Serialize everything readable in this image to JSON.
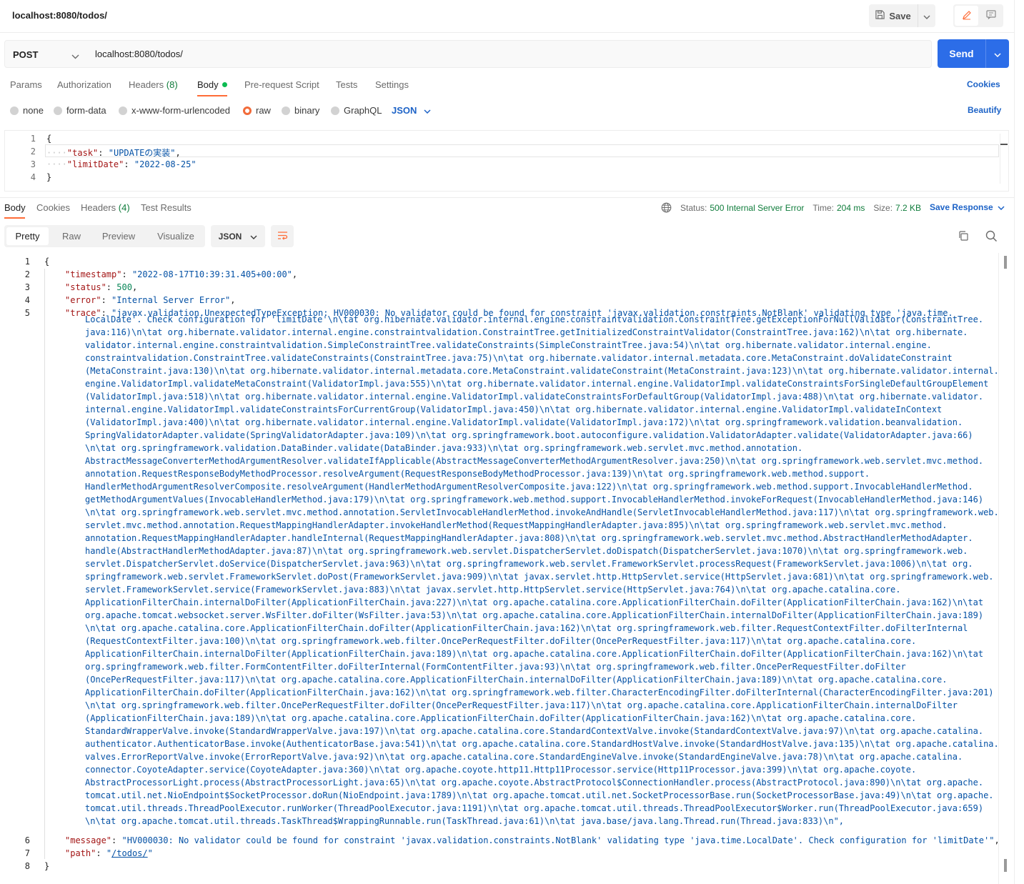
{
  "tab": {
    "title": "localhost:8080/todos/"
  },
  "toolbar": {
    "save_label": "Save"
  },
  "request": {
    "method": "POST",
    "url": "localhost:8080/todos/",
    "send_label": "Send",
    "tabs": {
      "params": "Params",
      "authorization": "Authorization",
      "headers": "Headers",
      "headers_count": "(8)",
      "body": "Body",
      "prerequest": "Pre-request Script",
      "tests": "Tests",
      "settings": "Settings"
    },
    "cookies_label": "Cookies",
    "body_modes": {
      "none": "none",
      "form_data": "form-data",
      "urlencoded": "x-www-form-urlencoded",
      "raw": "raw",
      "binary": "binary",
      "graphql": "GraphQL",
      "type": "JSON"
    },
    "beautify_label": "Beautify",
    "editor": {
      "line_numbers": [
        "1",
        "2",
        "3",
        "4"
      ],
      "open_brace": "{",
      "close_brace": "}",
      "task_key": "\"task\"",
      "task_value": "\"UPDATEの実装\"",
      "limit_key": "\"limitDate\"",
      "limit_value": "\"2022-08-25\""
    }
  },
  "response": {
    "tabs": {
      "body": "Body",
      "cookies": "Cookies",
      "headers": "Headers",
      "headers_count": "(4)",
      "test_results": "Test Results"
    },
    "status_label": "Status:",
    "status_value": "500 Internal Server Error",
    "time_label": "Time:",
    "time_value": "204 ms",
    "size_label": "Size:",
    "size_value": "7.2 KB",
    "save_response_label": "Save Response",
    "views": {
      "pretty": "Pretty",
      "raw": "Raw",
      "preview": "Preview",
      "visualize": "Visualize"
    },
    "format": "JSON",
    "line_numbers": [
      "1",
      "2",
      "3",
      "4",
      "5",
      "6",
      "7",
      "8"
    ],
    "body": {
      "open_brace": "{",
      "close_brace": "}",
      "timestamp_key": "\"timestamp\"",
      "timestamp_value": "\"2022-08-17T10:39:31.405+00:00\"",
      "status_key": "\"status\"",
      "status_value": "500",
      "error_key": "\"error\"",
      "error_value": "\"Internal Server Error\"",
      "trace_key": "\"trace\"",
      "trace_first": "\"javax.validation.UnexpectedTypeException: HV000030: No validator could be found for constraint 'javax.validation.constraints.NotBlank' validating type 'java.time.",
      "trace_lines": [
        "LocalDate'. Check configuration for 'limitDate'\\n\\tat org.hibernate.validator.internal.engine.constraintvalidation.ConstraintTree.getExceptionForNullValidator(ConstraintTree.",
        "java:116)\\n\\tat org.hibernate.validator.internal.engine.constraintvalidation.ConstraintTree.getInitializedConstraintValidator(ConstraintTree.java:162)\\n\\tat org.hibernate.",
        "validator.internal.engine.constraintvalidation.SimpleConstraintTree.validateConstraints(SimpleConstraintTree.java:54)\\n\\tat org.hibernate.validator.internal.engine.",
        "constraintvalidation.ConstraintTree.validateConstraints(ConstraintTree.java:75)\\n\\tat org.hibernate.validator.internal.metadata.core.MetaConstraint.doValidateConstraint",
        "(MetaConstraint.java:130)\\n\\tat org.hibernate.validator.internal.metadata.core.MetaConstraint.validateConstraint(MetaConstraint.java:123)\\n\\tat org.hibernate.validator.internal.",
        "engine.ValidatorImpl.validateMetaConstraint(ValidatorImpl.java:555)\\n\\tat org.hibernate.validator.internal.engine.ValidatorImpl.validateConstraintsForSingleDefaultGroupElement",
        "(ValidatorImpl.java:518)\\n\\tat org.hibernate.validator.internal.engine.ValidatorImpl.validateConstraintsForDefaultGroup(ValidatorImpl.java:488)\\n\\tat org.hibernate.validator.",
        "internal.engine.ValidatorImpl.validateConstraintsForCurrentGroup(ValidatorImpl.java:450)\\n\\tat org.hibernate.validator.internal.engine.ValidatorImpl.validateInContext",
        "(ValidatorImpl.java:400)\\n\\tat org.hibernate.validator.internal.engine.ValidatorImpl.validate(ValidatorImpl.java:172)\\n\\tat org.springframework.validation.beanvalidation.",
        "SpringValidatorAdapter.validate(SpringValidatorAdapter.java:109)\\n\\tat org.springframework.boot.autoconfigure.validation.ValidatorAdapter.validate(ValidatorAdapter.java:66)",
        "\\n\\tat org.springframework.validation.DataBinder.validate(DataBinder.java:933)\\n\\tat org.springframework.web.servlet.mvc.method.annotation.",
        "AbstractMessageConverterMethodArgumentResolver.validateIfApplicable(AbstractMessageConverterMethodArgumentResolver.java:250)\\n\\tat org.springframework.web.servlet.mvc.method.",
        "annotation.RequestResponseBodyMethodProcessor.resolveArgument(RequestResponseBodyMethodProcessor.java:139)\\n\\tat org.springframework.web.method.support.",
        "HandlerMethodArgumentResolverComposite.resolveArgument(HandlerMethodArgumentResolverComposite.java:122)\\n\\tat org.springframework.web.method.support.InvocableHandlerMethod.",
        "getMethodArgumentValues(InvocableHandlerMethod.java:179)\\n\\tat org.springframework.web.method.support.InvocableHandlerMethod.invokeForRequest(InvocableHandlerMethod.java:146)",
        "\\n\\tat org.springframework.web.servlet.mvc.method.annotation.ServletInvocableHandlerMethod.invokeAndHandle(ServletInvocableHandlerMethod.java:117)\\n\\tat org.springframework.web.",
        "servlet.mvc.method.annotation.RequestMappingHandlerAdapter.invokeHandlerMethod(RequestMappingHandlerAdapter.java:895)\\n\\tat org.springframework.web.servlet.mvc.method.",
        "annotation.RequestMappingHandlerAdapter.handleInternal(RequestMappingHandlerAdapter.java:808)\\n\\tat org.springframework.web.servlet.mvc.method.AbstractHandlerMethodAdapter.",
        "handle(AbstractHandlerMethodAdapter.java:87)\\n\\tat org.springframework.web.servlet.DispatcherServlet.doDispatch(DispatcherServlet.java:1070)\\n\\tat org.springframework.web.",
        "servlet.DispatcherServlet.doService(DispatcherServlet.java:963)\\n\\tat org.springframework.web.servlet.FrameworkServlet.processRequest(FrameworkServlet.java:1006)\\n\\tat org.",
        "springframework.web.servlet.FrameworkServlet.doPost(FrameworkServlet.java:909)\\n\\tat javax.servlet.http.HttpServlet.service(HttpServlet.java:681)\\n\\tat org.springframework.web.",
        "servlet.FrameworkServlet.service(FrameworkServlet.java:883)\\n\\tat javax.servlet.http.HttpServlet.service(HttpServlet.java:764)\\n\\tat org.apache.catalina.core.",
        "ApplicationFilterChain.internalDoFilter(ApplicationFilterChain.java:227)\\n\\tat org.apache.catalina.core.ApplicationFilterChain.doFilter(ApplicationFilterChain.java:162)\\n\\tat",
        "org.apache.tomcat.websocket.server.WsFilter.doFilter(WsFilter.java:53)\\n\\tat org.apache.catalina.core.ApplicationFilterChain.internalDoFilter(ApplicationFilterChain.java:189)",
        "\\n\\tat org.apache.catalina.core.ApplicationFilterChain.doFilter(ApplicationFilterChain.java:162)\\n\\tat org.springframework.web.filter.RequestContextFilter.doFilterInternal",
        "(RequestContextFilter.java:100)\\n\\tat org.springframework.web.filter.OncePerRequestFilter.doFilter(OncePerRequestFilter.java:117)\\n\\tat org.apache.catalina.core.",
        "ApplicationFilterChain.internalDoFilter(ApplicationFilterChain.java:189)\\n\\tat org.apache.catalina.core.ApplicationFilterChain.doFilter(ApplicationFilterChain.java:162)\\n\\tat",
        "org.springframework.web.filter.FormContentFilter.doFilterInternal(FormContentFilter.java:93)\\n\\tat org.springframework.web.filter.OncePerRequestFilter.doFilter",
        "(OncePerRequestFilter.java:117)\\n\\tat org.apache.catalina.core.ApplicationFilterChain.internalDoFilter(ApplicationFilterChain.java:189)\\n\\tat org.apache.catalina.core.",
        "ApplicationFilterChain.doFilter(ApplicationFilterChain.java:162)\\n\\tat org.springframework.web.filter.CharacterEncodingFilter.doFilterInternal(CharacterEncodingFilter.java:201)",
        "\\n\\tat org.springframework.web.filter.OncePerRequestFilter.doFilter(OncePerRequestFilter.java:117)\\n\\tat org.apache.catalina.core.ApplicationFilterChain.internalDoFilter",
        "(ApplicationFilterChain.java:189)\\n\\tat org.apache.catalina.core.ApplicationFilterChain.doFilter(ApplicationFilterChain.java:162)\\n\\tat org.apache.catalina.core.",
        "StandardWrapperValve.invoke(StandardWrapperValve.java:197)\\n\\tat org.apache.catalina.core.StandardContextValve.invoke(StandardContextValve.java:97)\\n\\tat org.apache.catalina.",
        "authenticator.AuthenticatorBase.invoke(AuthenticatorBase.java:541)\\n\\tat org.apache.catalina.core.StandardHostValve.invoke(StandardHostValve.java:135)\\n\\tat org.apache.catalina.",
        "valves.ErrorReportValve.invoke(ErrorReportValve.java:92)\\n\\tat org.apache.catalina.core.StandardEngineValve.invoke(StandardEngineValve.java:78)\\n\\tat org.apache.catalina.",
        "connector.CoyoteAdapter.service(CoyoteAdapter.java:360)\\n\\tat org.apache.coyote.http11.Http11Processor.service(Http11Processor.java:399)\\n\\tat org.apache.coyote.",
        "AbstractProcessorLight.process(AbstractProcessorLight.java:65)\\n\\tat org.apache.coyote.AbstractProtocol$ConnectionHandler.process(AbstractProtocol.java:890)\\n\\tat org.apache.",
        "tomcat.util.net.NioEndpoint$SocketProcessor.doRun(NioEndpoint.java:1789)\\n\\tat org.apache.tomcat.util.net.SocketProcessorBase.run(SocketProcessorBase.java:49)\\n\\tat org.apache.",
        "tomcat.util.threads.ThreadPoolExecutor.runWorker(ThreadPoolExecutor.java:1191)\\n\\tat org.apache.tomcat.util.threads.ThreadPoolExecutor$Worker.run(ThreadPoolExecutor.java:659)",
        "\\n\\tat org.apache.tomcat.util.threads.TaskThread$WrappingRunnable.run(TaskThread.java:61)\\n\\tat java.base/java.lang.Thread.run(Thread.java:833)\\n\","
      ],
      "message_key": "\"message\"",
      "message_value": "\"HV000030: No validator could be found for constraint 'javax.validation.constraints.NotBlank' validating type 'java.time.LocalDate'. Check configuration for 'limitDate'\"",
      "path_key": "\"path\"",
      "path_value_open": "\"",
      "path_value_link": "/todos/",
      "path_value_close": "\""
    }
  }
}
